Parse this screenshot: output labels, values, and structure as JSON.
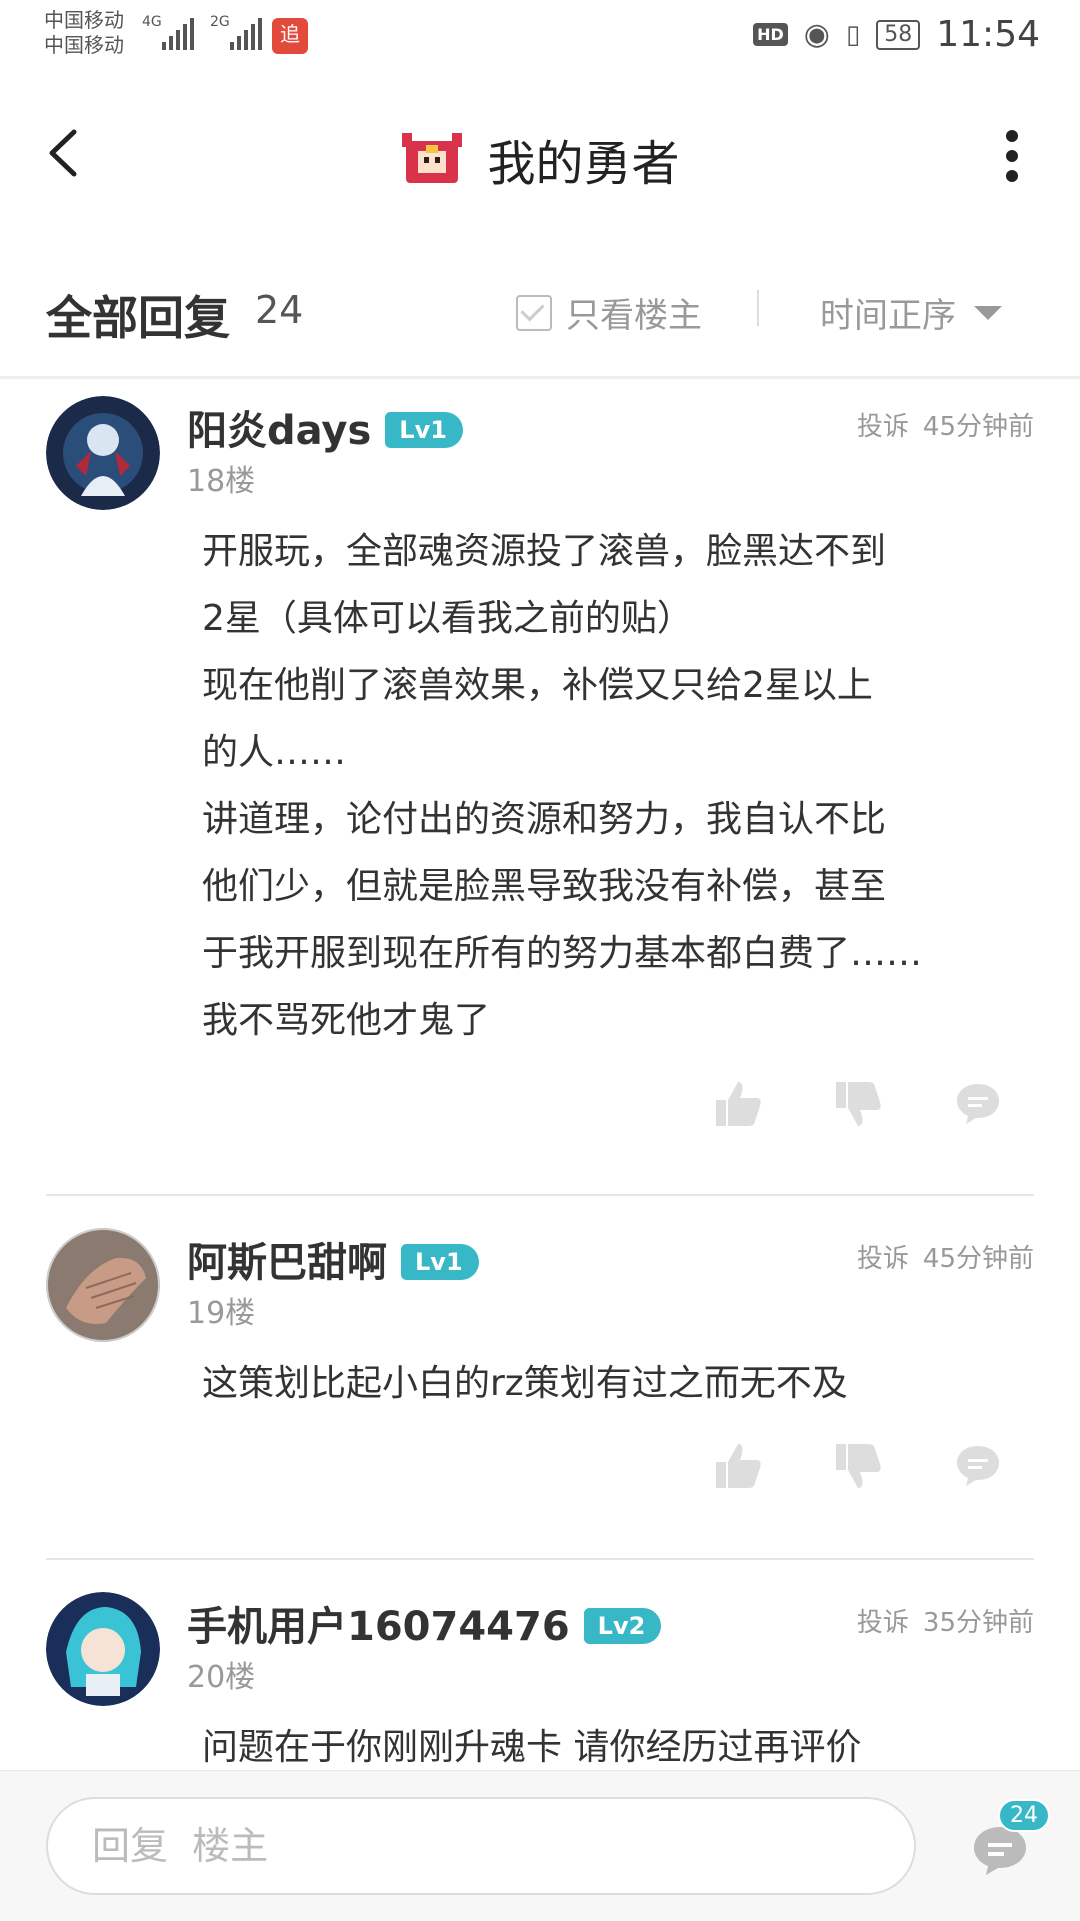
{
  "status_bar": {
    "carrier1": "中国移动",
    "carrier2": "中国移动",
    "net1": "4G",
    "net2": "2G",
    "app_badge": "追",
    "hd": "HD",
    "battery": "58",
    "time": "11:54"
  },
  "header": {
    "title": "我的勇者",
    "icons": {
      "back": "back-arrow-icon",
      "game": "game-logo-icon",
      "more": "more-vertical-icon"
    }
  },
  "reply_bar": {
    "title": "全部回复",
    "count": "24",
    "only_host": "只看楼主",
    "sort": "时间正序"
  },
  "posts": [
    {
      "username": "阳炎days",
      "level": "Lv1",
      "report": "投诉",
      "time": "45分钟前",
      "floor": "18楼",
      "lines": [
        "开服玩，全部魂资源投了滚兽，脸黑达不到",
        "2星（具体可以看我之前的贴）",
        "现在他削了滚兽效果，补偿又只给2星以上",
        "的人……",
        "讲道理，论付出的资源和努力，我自认不比",
        "他们少，但就是脸黑导致我没有补偿，甚至",
        "于我开服到现在所有的努力基本都白费了……",
        "我不骂死他才鬼了"
      ]
    },
    {
      "username": "阿斯巴甜啊",
      "level": "Lv1",
      "report": "投诉",
      "time": "45分钟前",
      "floor": "19楼",
      "lines": [
        "这策划比起小白的rz策划有过之而无不及"
      ]
    },
    {
      "username": "手机用户16074476",
      "level": "Lv2",
      "report": "投诉",
      "time": "35分钟前",
      "floor": "20楼",
      "lines": [
        "问题在于你刚刚升魂卡 请你经历过再评价"
      ]
    }
  ],
  "bottom_bar": {
    "placeholder": "回复  楼主",
    "comment_count": "24"
  },
  "colors": {
    "accent": "#38b7c7",
    "badge_red": "#e24a3b"
  }
}
